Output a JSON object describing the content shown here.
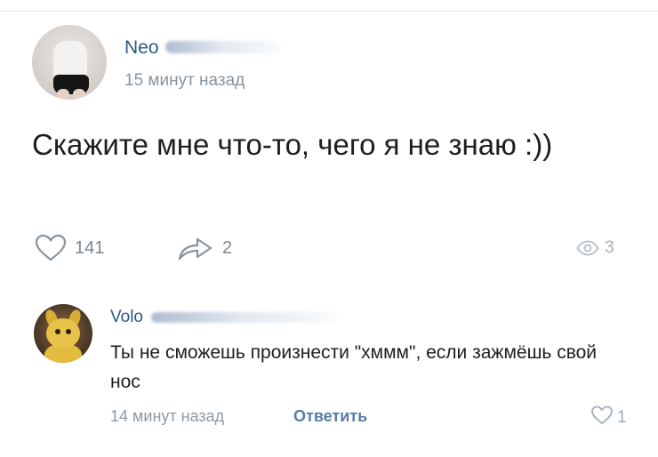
{
  "post": {
    "author": "Neo",
    "time": "15 минут назад",
    "text": "Скажите мне что-то, чего я не знаю :))",
    "likes": "141",
    "shares": "2",
    "views": "3"
  },
  "comment": {
    "author": "Volo",
    "text": "Ты не сможешь произнести \"хммм\", если зажмёшь свой нос",
    "time": "14 минут назад",
    "reply_label": "Ответить",
    "likes": "1"
  },
  "icons": {
    "like": "heart-icon",
    "share": "share-arrow-icon",
    "views": "eye-icon",
    "comment_like": "heart-icon"
  },
  "colors": {
    "author_link": "#2a5885",
    "secondary_text": "#8a949e",
    "icon_gray": "#7b8591"
  }
}
